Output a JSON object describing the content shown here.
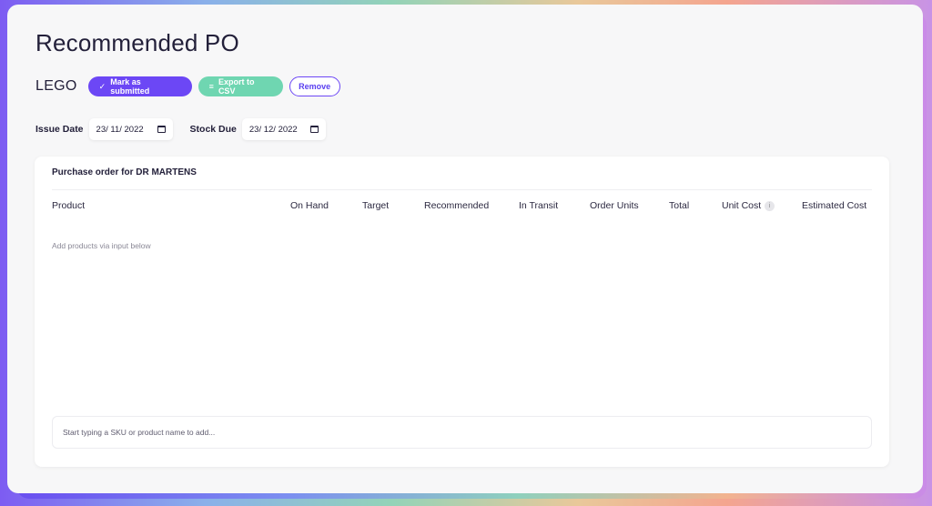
{
  "page": {
    "title": "Recommended PO"
  },
  "brand": {
    "name": "LEGO"
  },
  "actions": {
    "mark_submitted": "Mark as submitted",
    "export_csv": "Export to CSV",
    "remove": "Remove"
  },
  "dates": {
    "issue_label": "Issue Date",
    "issue_value": "23/ 11/ 2022",
    "stock_label": "Stock Due",
    "stock_value": "23/ 12/ 2022"
  },
  "order": {
    "title": "Purchase order for DR MARTENS",
    "columns": [
      "Product",
      "On Hand",
      "Target",
      "Recommended",
      "In Transit",
      "Order Units",
      "Total",
      "Unit Cost",
      "Estimated Cost"
    ],
    "empty_hint": "Add products via input below",
    "add_placeholder": "Start typing a SKU or product name to add..."
  },
  "icons": {
    "check": "check-icon",
    "list": "list-icon",
    "calendar": "calendar-icon",
    "info": "info-icon"
  },
  "colors": {
    "primary": "#6c47f5",
    "green": "#6fd6b1",
    "text": "#23203a"
  }
}
